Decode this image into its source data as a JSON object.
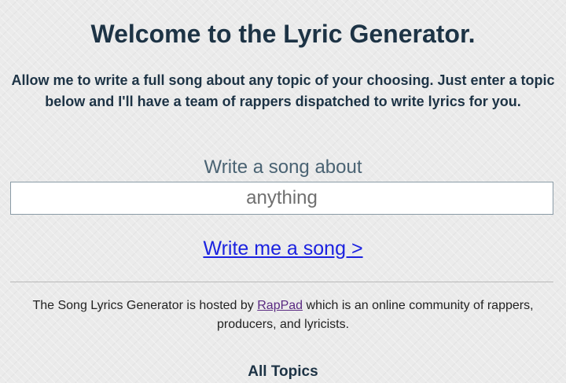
{
  "header": {
    "title": "Welcome to the Lyric Generator."
  },
  "intro": {
    "text": "Allow me to write a full song about any topic of your choosing. Just enter a topic below and I'll have a team of rappers dispatched to write lyrics for you."
  },
  "form": {
    "prompt_label": "Write a song about",
    "topic_placeholder": "anything",
    "topic_value": "",
    "submit_label": "Write me a song >"
  },
  "footer": {
    "text_before": "The Song Lyrics Generator is hosted by ",
    "link_label": "RapPad",
    "text_after": " which is an online community of rappers, producers, and lyricists."
  },
  "topics": {
    "heading": "All Topics"
  },
  "colors": {
    "heading": "#1d3345",
    "link": "#1b22e0",
    "visited_link": "#5a2a82",
    "background": "#ebebeb"
  }
}
